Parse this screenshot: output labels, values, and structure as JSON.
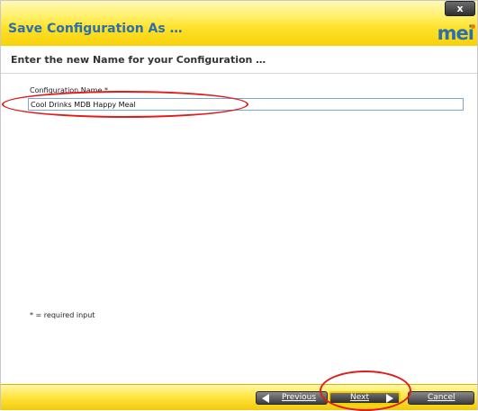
{
  "window": {
    "title": "Save Configuration As …",
    "close_label": "x",
    "logo_text": "mei",
    "subtitle": "Enter the new Name for your Configuration …"
  },
  "form": {
    "field_label": "Configuration Name *",
    "field_value": "Cool Drinks MDB Happy Meal",
    "required_note": "* = required input"
  },
  "buttons": {
    "previous": "Previous",
    "next": "Next",
    "cancel": "Cancel"
  },
  "colors": {
    "accent": "#2a6fae",
    "bar": "#ffe12a",
    "annotation": "#e21b1b"
  }
}
